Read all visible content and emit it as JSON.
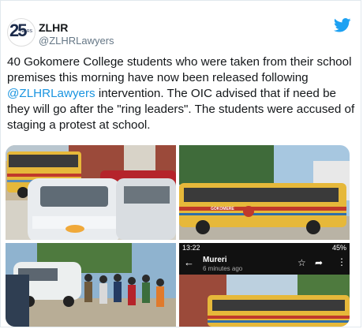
{
  "tweet": {
    "avatar": {
      "number": "25",
      "years_text": "YEARS"
    },
    "author_name": "ZLHR",
    "author_handle": "@ZLHRLawyers",
    "text_before": "40 Gokomere College students who were taken from their school premises this morning have now been released following ",
    "mention": "@ZLHRLawyers",
    "text_after": " intervention. The OIC advised that if need be they will go after the \"ring leaders\". The students were accused of staging a protest at school.",
    "platform_icon": "twitter-bird-icon"
  },
  "media": {
    "photo4": {
      "status_time": "13:22",
      "status_battery": "45%",
      "app_title": "Mureri",
      "app_subtitle": "6 minutes ago"
    },
    "bus_lettering": "GOKOMERE"
  },
  "colors": {
    "twitter_blue": "#1da1f2",
    "mention_blue": "#1b95e0",
    "bus_yellow": "#e6b83a",
    "bus_stripe": "#c0392b"
  }
}
